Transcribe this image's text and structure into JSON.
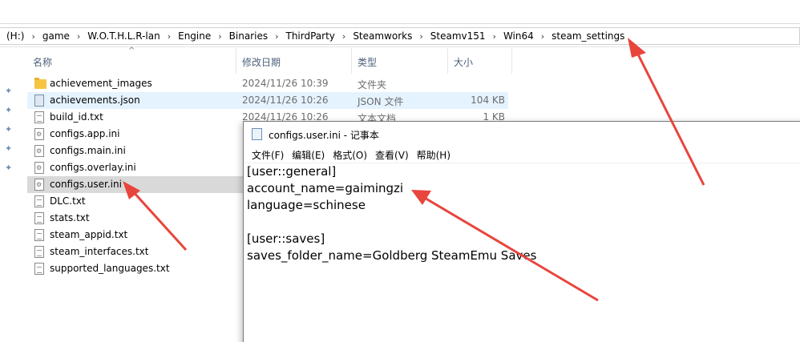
{
  "breadcrumb": [
    "(H:)",
    "game",
    "W.O.T.H.L.R-lan",
    "Engine",
    "Binaries",
    "ThirdParty",
    "Steamworks",
    "Steamv151",
    "Win64",
    "steam_settings"
  ],
  "columns": {
    "name": "名称",
    "date": "修改日期",
    "type": "类型",
    "size": "大小"
  },
  "files": [
    {
      "icon": "folder-icon",
      "name": "achievement_images",
      "date": "2024/11/26 10:39",
      "type": "文件夹",
      "size": ""
    },
    {
      "icon": "json-file-icon",
      "name": "achievements.json",
      "date": "2024/11/26 10:26",
      "type": "JSON 文件",
      "size": "104 KB"
    },
    {
      "icon": "text-file-icon",
      "name": "build_id.txt",
      "date": "2024/11/26 10:26",
      "type": "文本文档",
      "size": "1 KB"
    },
    {
      "icon": "ini-file-icon",
      "name": "configs.app.ini",
      "date": "",
      "type": "",
      "size": ""
    },
    {
      "icon": "ini-file-icon",
      "name": "configs.main.ini",
      "date": "",
      "type": "",
      "size": ""
    },
    {
      "icon": "ini-file-icon",
      "name": "configs.overlay.ini",
      "date": "",
      "type": "",
      "size": ""
    },
    {
      "icon": "ini-file-icon",
      "name": "configs.user.ini",
      "date": "",
      "type": "",
      "size": ""
    },
    {
      "icon": "text-file-icon",
      "name": "DLC.txt",
      "date": "",
      "type": "",
      "size": ""
    },
    {
      "icon": "text-file-icon",
      "name": "stats.txt",
      "date": "",
      "type": "",
      "size": ""
    },
    {
      "icon": "text-file-icon",
      "name": "steam_appid.txt",
      "date": "",
      "type": "",
      "size": ""
    },
    {
      "icon": "text-file-icon",
      "name": "steam_interfaces.txt",
      "date": "",
      "type": "",
      "size": ""
    },
    {
      "icon": "text-file-icon",
      "name": "supported_languages.txt",
      "date": "",
      "type": "",
      "size": ""
    }
  ],
  "notepad": {
    "title": "configs.user.ini - 记事本",
    "menus": [
      "文件(F)",
      "编辑(E)",
      "格式(O)",
      "查看(V)",
      "帮助(H)"
    ],
    "lines": [
      "[user::general]",
      "account_name=gaimingzi",
      "language=schinese",
      "",
      "[user::saves]",
      "saves_folder_name=Goldberg SteamEmu Saves"
    ]
  },
  "colors": {
    "annotation_arrow": "#e8453c",
    "selection_light": "#e5f3ff",
    "selection_gray": "#d9d9d9"
  }
}
